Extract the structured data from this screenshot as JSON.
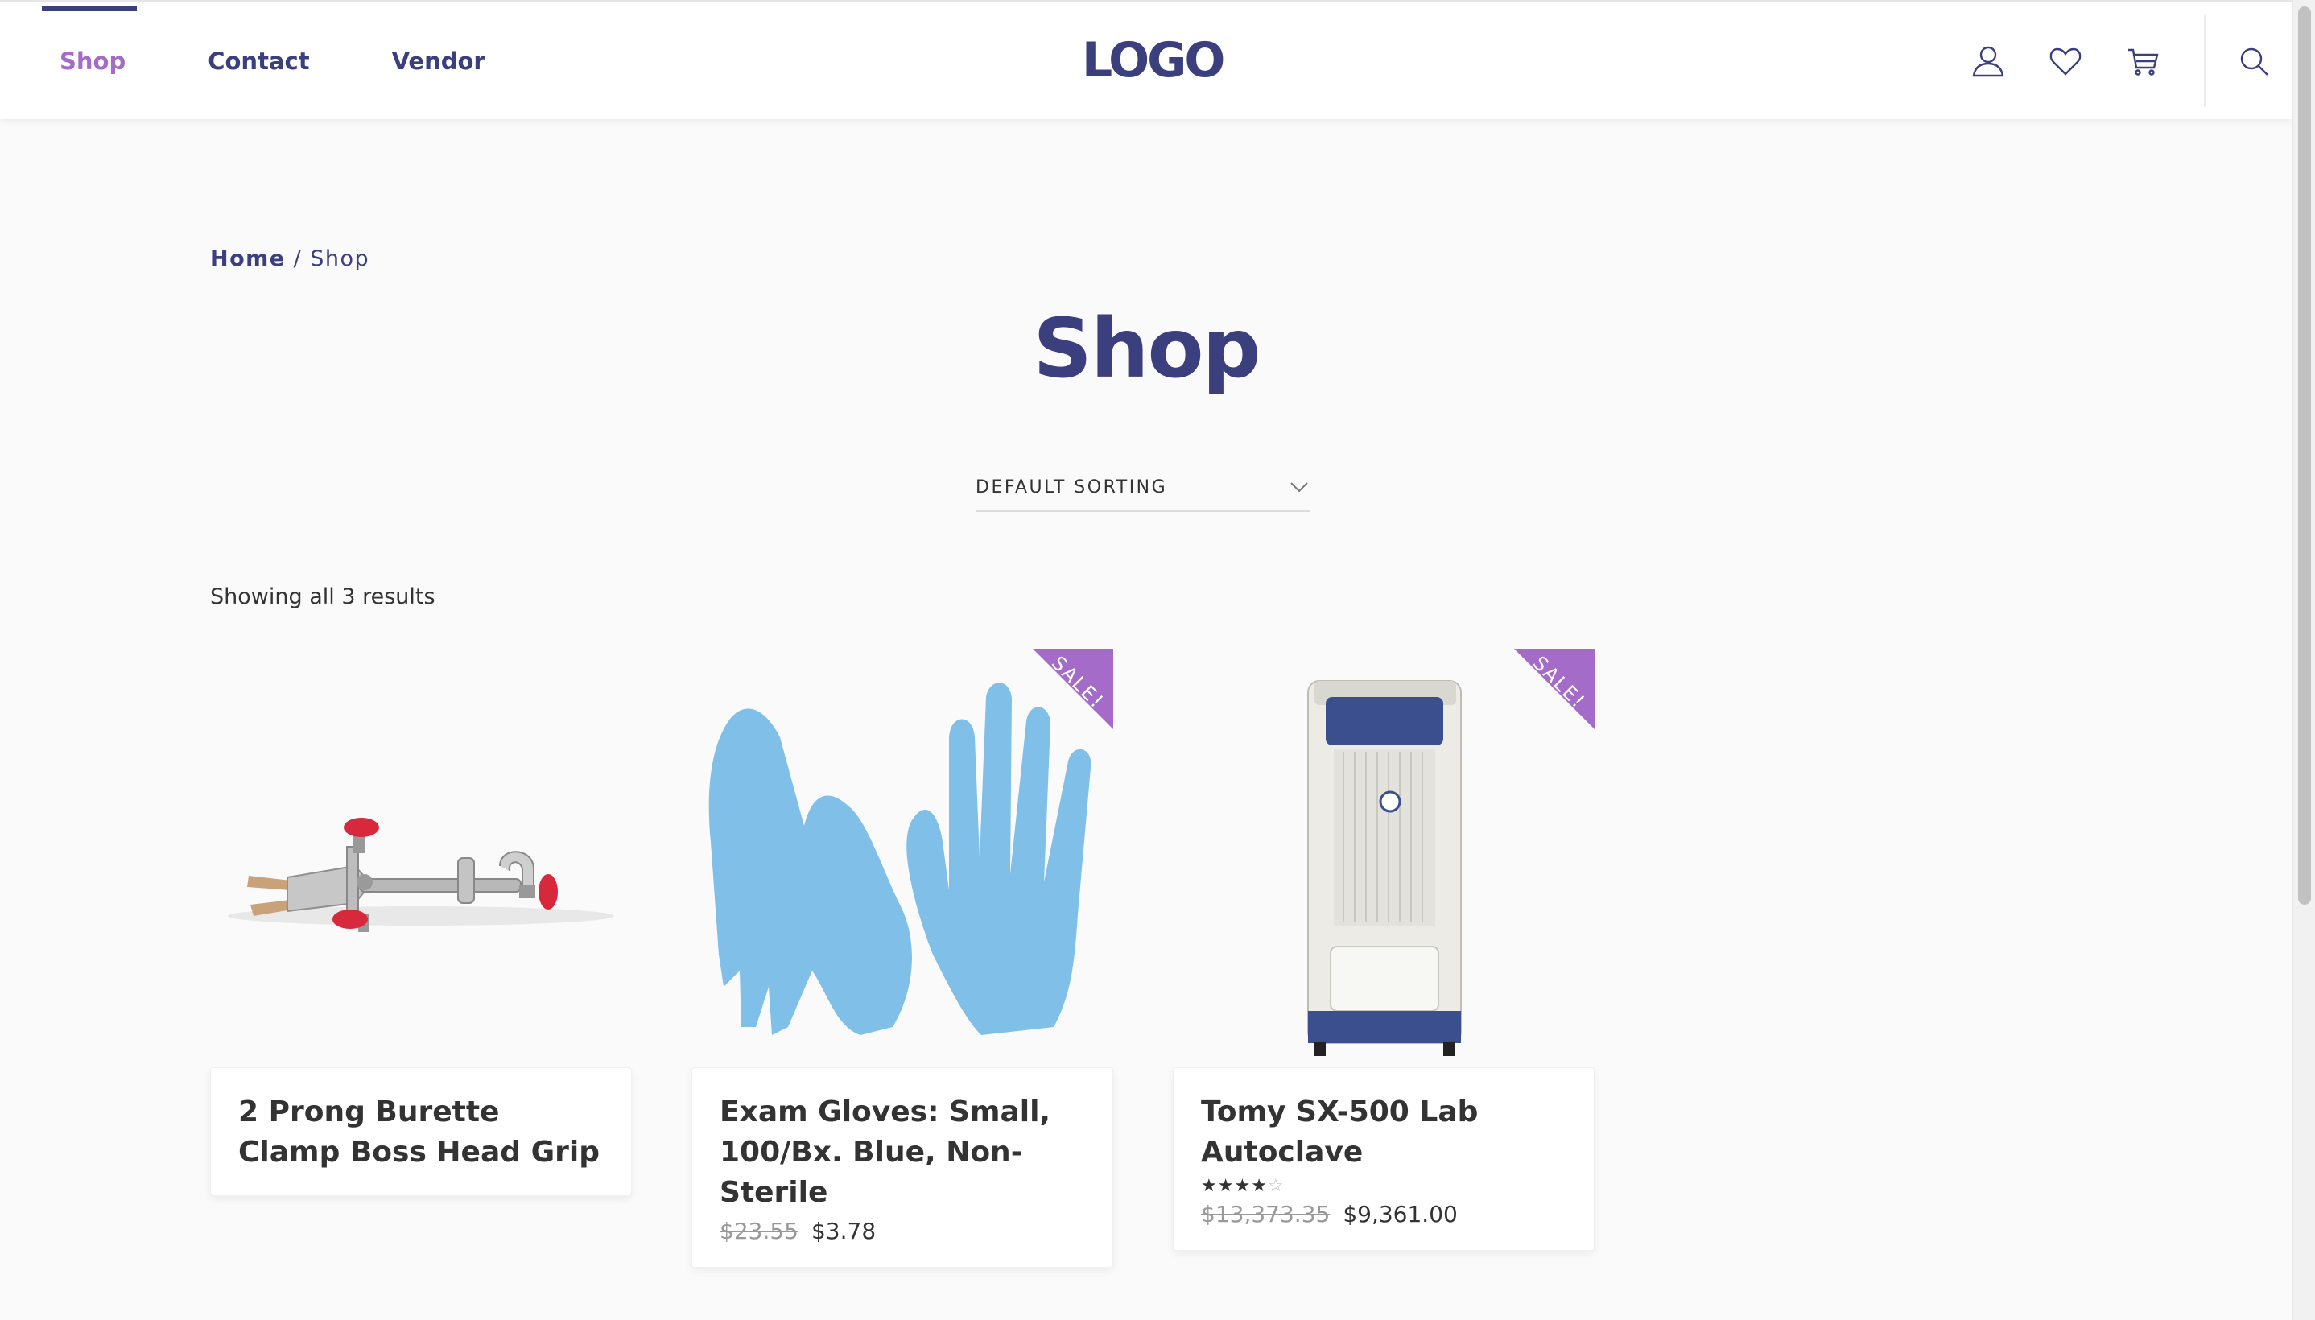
{
  "nav": {
    "items": [
      {
        "label": "Shop",
        "active": true
      },
      {
        "label": "Contact",
        "active": false
      },
      {
        "label": "Vendor",
        "active": false
      }
    ],
    "logo": "LOGO"
  },
  "header_icons": [
    "user-icon",
    "heart-icon",
    "cart-icon",
    "search-icon"
  ],
  "breadcrumb": {
    "home": "Home",
    "separator": "/",
    "current": "Shop"
  },
  "page": {
    "title": "Shop",
    "sorting": "DEFAULT SORTING",
    "result_count": "Showing all 3 results"
  },
  "products": [
    {
      "name": "2 Prong Burette Clamp Boss Head Grip",
      "sale": false
    },
    {
      "name": "Exam Gloves: Small, 100/Bx. Blue, Non-Sterile",
      "sale": true,
      "sale_label": "SALE!",
      "old_price": "$23.55",
      "price": "$3.78"
    },
    {
      "name": "Tomy SX-500 Lab Autoclave",
      "sale": true,
      "sale_label": "SALE!",
      "rating": 4,
      "rating_max": 5,
      "old_price": "$13,373.35",
      "price": "$9,361.00"
    }
  ],
  "colors": {
    "brand": "#3b3f7e",
    "accent": "#a56bc8",
    "background": "#fafafa"
  }
}
